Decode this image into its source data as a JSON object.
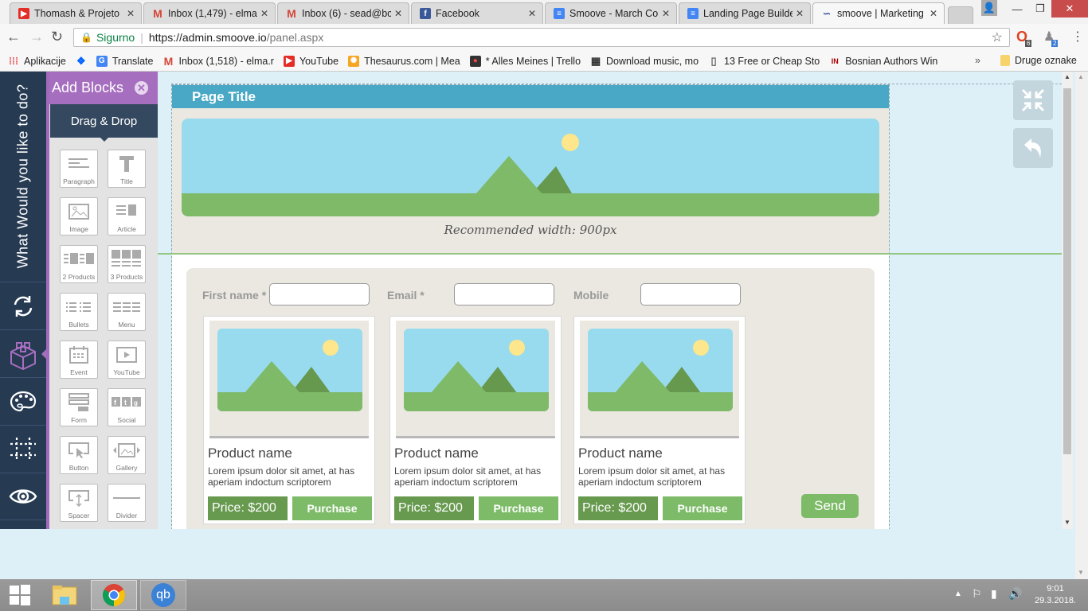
{
  "browser": {
    "tabs": [
      {
        "title": "Thomash & Projeto",
        "icon": "youtube-icon",
        "active": false
      },
      {
        "title": "Inbox (1,479) - elma",
        "icon": "gmail-icon",
        "active": false
      },
      {
        "title": "Inbox (6) - sead@bc",
        "icon": "gmail-icon",
        "active": false
      },
      {
        "title": "Facebook",
        "icon": "facebook-icon",
        "active": false
      },
      {
        "title": "Smoove - March Co",
        "icon": "google-docs-icon",
        "active": false
      },
      {
        "title": "Landing Page Builde",
        "icon": "google-docs-icon",
        "active": false
      },
      {
        "title": "smoove | Marketing",
        "icon": "smoove-icon",
        "active": true
      }
    ],
    "tab_close": "✕",
    "address": {
      "secure_label": "Sigurno",
      "url_host": "https://admin.smoove.io",
      "url_path": "/panel.aspx"
    },
    "extensions": [
      {
        "name": "opera-extension",
        "badge": "6"
      },
      {
        "name": "profile-extension",
        "badge": "2"
      }
    ],
    "bookmarks": [
      {
        "label": "Aplikacije",
        "icon": "apps-grid-icon"
      },
      {
        "label": "",
        "icon": "dropbox-icon"
      },
      {
        "label": "Translate",
        "icon": "google-translate-icon"
      },
      {
        "label": "Inbox (1,518) - elma.r",
        "icon": "gmail-icon"
      },
      {
        "label": "YouTube",
        "icon": "youtube-icon"
      },
      {
        "label": "Thesaurus.com | Mea",
        "icon": "thesaurus-icon"
      },
      {
        "label": "* Alles Meines | Trello",
        "icon": "trello-icon"
      },
      {
        "label": "Download music, mo",
        "icon": "download-icon"
      },
      {
        "label": "13 Free or Cheap Sto",
        "icon": "page-icon"
      },
      {
        "label": "Bosnian Authors Win",
        "icon": "insa-icon"
      }
    ],
    "bookmarks_overflow": "»",
    "other_bookmarks": "Druge oznake"
  },
  "app": {
    "leftnav": {
      "vertical_title": "What Would you like to do?",
      "items": [
        {
          "name": "sync",
          "active": false
        },
        {
          "name": "blocks",
          "active": true
        },
        {
          "name": "design-palette",
          "active": false
        },
        {
          "name": "spacing",
          "active": false
        },
        {
          "name": "preview",
          "active": false
        }
      ]
    },
    "add_blocks": {
      "title": "Add Blocks",
      "close_icon": "✕",
      "tab_label": "Drag & Drop",
      "blocks": [
        {
          "label": "Paragraph",
          "icon": "paragraph-icon"
        },
        {
          "label": "Title",
          "icon": "title-icon"
        },
        {
          "label": "Image",
          "icon": "image-icon"
        },
        {
          "label": "Article",
          "icon": "article-icon"
        },
        {
          "label": "2 Products",
          "icon": "two-products-icon"
        },
        {
          "label": "3 Products",
          "icon": "three-products-icon"
        },
        {
          "label": "Bullets",
          "icon": "bullets-icon"
        },
        {
          "label": "Menu",
          "icon": "menu-icon"
        },
        {
          "label": "Event",
          "icon": "calendar-icon"
        },
        {
          "label": "YouTube",
          "icon": "video-icon"
        },
        {
          "label": "Form",
          "icon": "form-icon"
        },
        {
          "label": "Social",
          "icon": "social-icon"
        },
        {
          "label": "Button",
          "icon": "button-icon"
        },
        {
          "label": "Gallery",
          "icon": "gallery-icon"
        },
        {
          "label": "Spacer",
          "icon": "spacer-icon"
        },
        {
          "label": "Divider",
          "icon": "divider-icon"
        }
      ]
    },
    "page": {
      "title": "Page Title",
      "hero_caption": "Recommended width: 900px",
      "form": {
        "fields": [
          {
            "label": "First name *",
            "value": ""
          },
          {
            "label": "Email *",
            "value": ""
          },
          {
            "label": "Mobile",
            "value": ""
          }
        ],
        "send_label": "Send"
      },
      "products": [
        {
          "name": "Product name",
          "description": "Lorem ipsum dolor sit amet, at has aperiam indoctum scriptorem",
          "price": "Price: $200",
          "button": "Purchase"
        },
        {
          "name": "Product name",
          "description": "Lorem ipsum dolor sit amet, at has aperiam indoctum scriptorem",
          "price": "Price: $200",
          "button": "Purchase"
        },
        {
          "name": "Product name",
          "description": "Lorem ipsum dolor sit amet, at has aperiam indoctum scriptorem",
          "price": "Price: $200",
          "button": "Purchase"
        }
      ]
    },
    "side_tools": [
      {
        "name": "collapse",
        "icon": "collapse-arrows-icon"
      },
      {
        "name": "undo",
        "icon": "undo-icon"
      }
    ]
  },
  "taskbar": {
    "apps": [
      {
        "name": "file-explorer",
        "active": false
      },
      {
        "name": "chrome",
        "active": true
      },
      {
        "name": "qbittorrent",
        "active": false,
        "label": "qb"
      }
    ],
    "clock": {
      "time": "9:01",
      "date": "29.3.2018."
    }
  },
  "colors": {
    "accent_purple": "#a66ebf",
    "nav_dark": "#263a52",
    "page_title_bar": "#48a8c5",
    "button_green": "#7dbb68",
    "price_green": "#679a4f"
  }
}
